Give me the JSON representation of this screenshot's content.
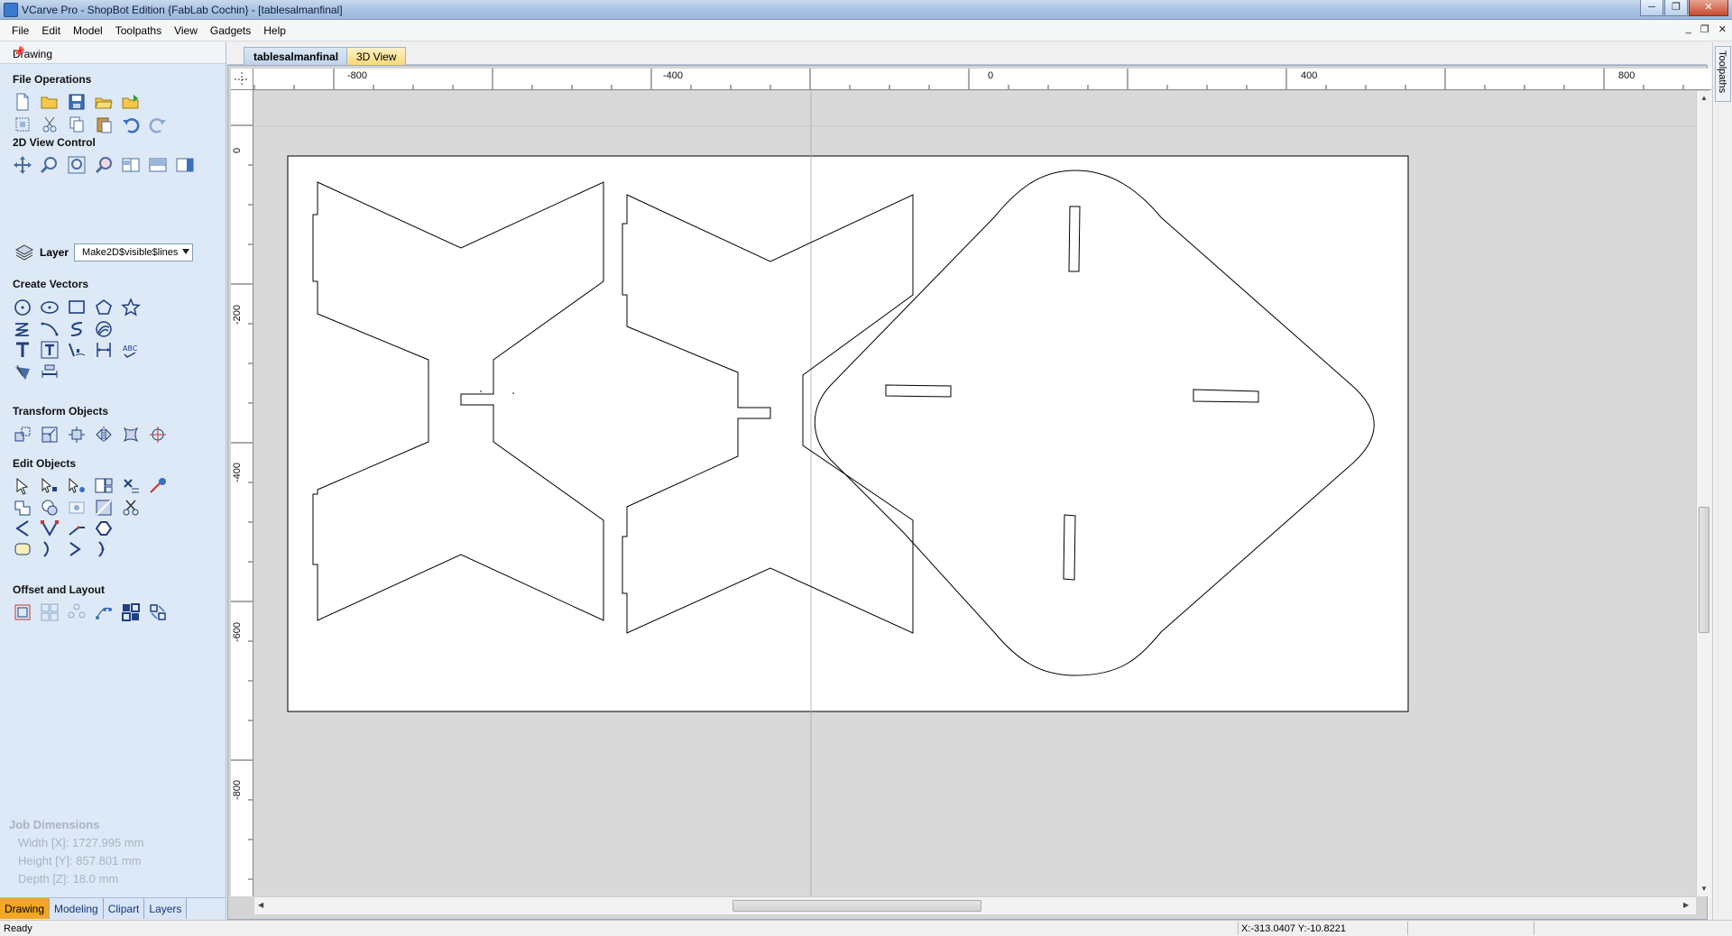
{
  "window": {
    "title": "VCarve Pro - ShopBot Edition {FabLab Cochin} - [tablesalmanfinal]",
    "minimize": "─",
    "restore": "❐",
    "close": "✕"
  },
  "menu": [
    "File",
    "Edit",
    "Model",
    "Toolpaths",
    "View",
    "Gadgets",
    "Help"
  ],
  "mdi": {
    "minimize": "_",
    "restore": "❐",
    "close": "✕"
  },
  "panel": {
    "title": "Drawing",
    "pin": "📌",
    "sections": {
      "file_operations": "File Operations",
      "view_control": "2D View Control",
      "create_vectors": "Create Vectors",
      "transform_objects": "Transform Objects",
      "edit_objects": "Edit Objects",
      "offset_layout": "Offset and Layout"
    },
    "layer_label": "Layer",
    "layer_value": "Make2D$visible$lines"
  },
  "job": {
    "title": "Job Dimensions",
    "width": "Width  [X]: 1727.995 mm",
    "height": "Height [Y]: 857.801 mm",
    "depth": "Depth  [Z]: 18.0 mm"
  },
  "bottom_tabs": [
    "Drawing",
    "Modeling",
    "Clipart",
    "Layers"
  ],
  "doc_tabs": {
    "active": "tablesalmanfinal",
    "view3d": "3D View"
  },
  "rulers": {
    "h_labels": [
      "-800",
      "-400",
      "0",
      "400",
      "800"
    ],
    "v_labels": [
      "0",
      "-200",
      "-400",
      "-600",
      "-800"
    ]
  },
  "right_tab": "Toolpaths",
  "status": {
    "text": "Ready",
    "coords": "X:-313.0407 Y:-10.8221"
  }
}
